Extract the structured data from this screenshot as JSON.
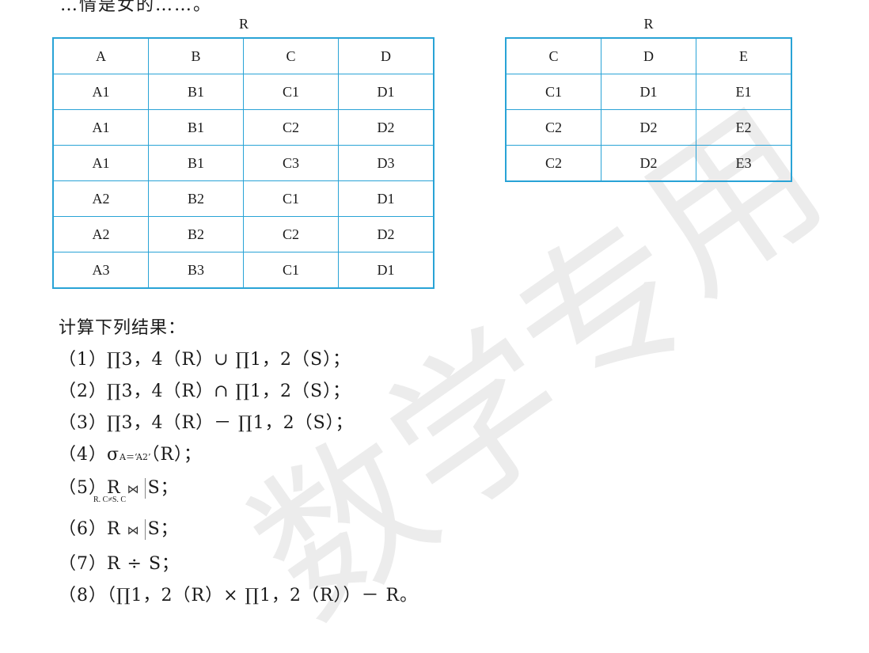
{
  "top_fragment": "…情是女的……。",
  "table_r": {
    "caption": "R",
    "rows": [
      [
        "A",
        "B",
        "C",
        "D"
      ],
      [
        "A1",
        "B1",
        "C1",
        "D1"
      ],
      [
        "A1",
        "B1",
        "C2",
        "D2"
      ],
      [
        "A1",
        "B1",
        "C3",
        "D3"
      ],
      [
        "A2",
        "B2",
        "C1",
        "D1"
      ],
      [
        "A2",
        "B2",
        "C2",
        "D2"
      ],
      [
        "A3",
        "B3",
        "C1",
        "D1"
      ]
    ]
  },
  "table_s": {
    "caption": "R",
    "rows": [
      [
        "C",
        "D",
        "E"
      ],
      [
        "C1",
        "D1",
        "E1"
      ],
      [
        "C2",
        "D2",
        "E2"
      ],
      [
        "C2",
        "D2",
        "E3"
      ]
    ]
  },
  "heading": "计算下列结果：",
  "questions": {
    "q1": "（1）∏3，4（R）∪ ∏1，2（S）；",
    "q2": "（2）∏3，4（R）∩ ∏1，2（S）；",
    "q3": "（3）∏3，4（R）－ ∏1，2（S）；",
    "q4_prefix": "（4）σ",
    "q4_sub": "A＝‘A2’",
    "q4_suffix": "（R）；",
    "q5_prefix": "（5）R",
    "q5_suffix": "S；",
    "q5_condition": "R. C≠S. C",
    "q6_prefix": "（6）R",
    "q6_suffix": "S；",
    "q7": "（7）R ÷ S；",
    "q8": "（8）（∏1，2（R）× ∏1，2（R））－ R。"
  },
  "join_symbol": "⋈",
  "watermark": [
    "数",
    "学",
    "专",
    "用"
  ],
  "colors": {
    "table_border": "#29a3d6",
    "watermark": "#ececec"
  }
}
